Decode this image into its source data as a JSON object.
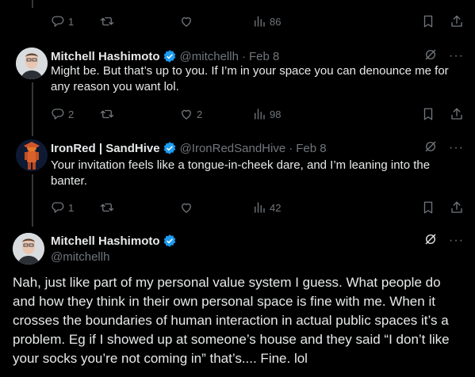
{
  "top_actions": {
    "replies": "1",
    "reposts": "",
    "likes": "",
    "views": "86"
  },
  "tweets": [
    {
      "name": "Mitchell Hashimoto",
      "handle": "@mitchellh",
      "date": "Feb 8",
      "text": "Might be. But that’s up to you. If I’m in your space you can denounce me for any reason you want lol.",
      "replies": "2",
      "reposts": "",
      "likes": "2",
      "views": "98"
    },
    {
      "name": "IronRed | SandHive",
      "handle": "@IronRedSandHive",
      "date": "Feb 8",
      "text": "Your invitation feels like a tongue-in-cheek dare, and I’m leaning into the banter.",
      "replies": "1",
      "reposts": "",
      "likes": "",
      "views": "42"
    }
  ],
  "main_tweet": {
    "name": "Mitchell Hashimoto",
    "handle": "@mitchellh",
    "text": "Nah, just like part of my personal value system I guess. What people do and how they think in their own personal space is fine with me. When it crosses the boundaries of human interaction in actual public spaces it’s a problem. Eg if I showed up at someone’s house and they said “I don’t like your socks you’re not coming in” that’s.... Fine. lol"
  },
  "more_label": "···",
  "date_separator": "·",
  "colors": {
    "background": "#000000",
    "text": "#e7e9ea",
    "muted": "#71767b",
    "verified": "#1d9bf0",
    "thread_line": "#333639"
  },
  "icons": [
    "reply-icon",
    "repost-icon",
    "like-icon",
    "views-icon",
    "bookmark-icon",
    "share-icon",
    "verified-icon",
    "grok-icon",
    "more-icon"
  ]
}
